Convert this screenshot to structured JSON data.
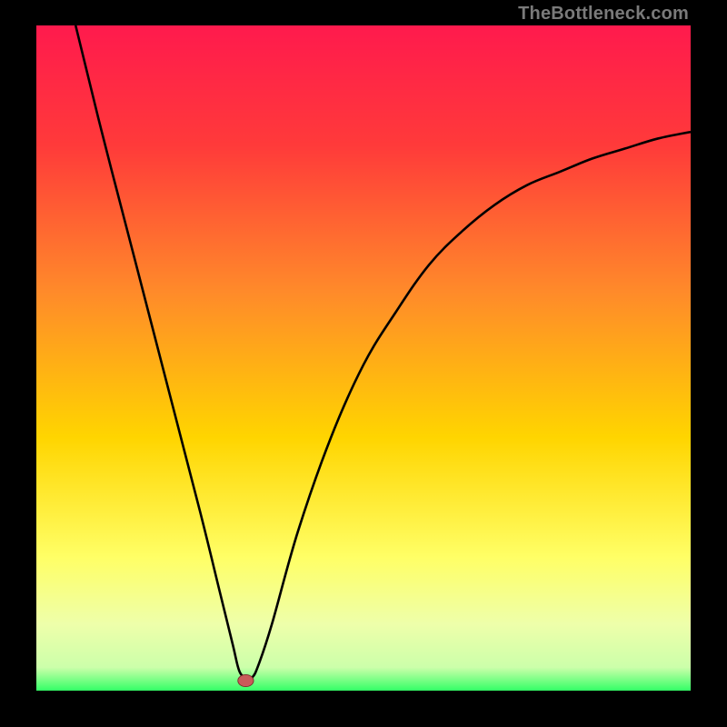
{
  "watermark": "TheBottleneck.com",
  "colors": {
    "frame_bg": "#000000",
    "gradient_top": "#ff1a4d",
    "gradient_mid1": "#ff7a33",
    "gradient_mid2": "#ffd500",
    "gradient_mid3": "#ffff66",
    "gradient_bottom": "#33ff66",
    "curve": "#000000",
    "marker_fill": "#c95a5a",
    "marker_stroke": "#7a2a2a"
  },
  "chart_data": {
    "type": "line",
    "title": "",
    "xlabel": "",
    "ylabel": "",
    "xlim": [
      0,
      100
    ],
    "ylim": [
      0,
      100
    ],
    "grid": false,
    "legend": false,
    "series": [
      {
        "name": "bottleneck-curve",
        "x": [
          6,
          10,
          15,
          20,
          25,
          28,
          30,
          31,
          32,
          33,
          34,
          36,
          40,
          45,
          50,
          55,
          60,
          65,
          70,
          75,
          80,
          85,
          90,
          95,
          100
        ],
        "y": [
          100,
          84,
          65,
          46,
          27,
          15,
          7,
          3,
          2,
          2,
          4,
          10,
          24,
          38,
          49,
          57,
          64,
          69,
          73,
          76,
          78,
          80,
          81.5,
          83,
          84
        ]
      }
    ],
    "marker": {
      "x": 32,
      "y": 1.5,
      "rx": 1.2,
      "ry": 0.9
    },
    "gradient_stops": [
      {
        "offset": 0.0,
        "color": "#ff1a4d"
      },
      {
        "offset": 0.18,
        "color": "#ff3a3a"
      },
      {
        "offset": 0.4,
        "color": "#ff8a2a"
      },
      {
        "offset": 0.62,
        "color": "#ffd500"
      },
      {
        "offset": 0.8,
        "color": "#ffff66"
      },
      {
        "offset": 0.9,
        "color": "#eeffaa"
      },
      {
        "offset": 0.965,
        "color": "#ccffaa"
      },
      {
        "offset": 1.0,
        "color": "#33ff66"
      }
    ]
  }
}
